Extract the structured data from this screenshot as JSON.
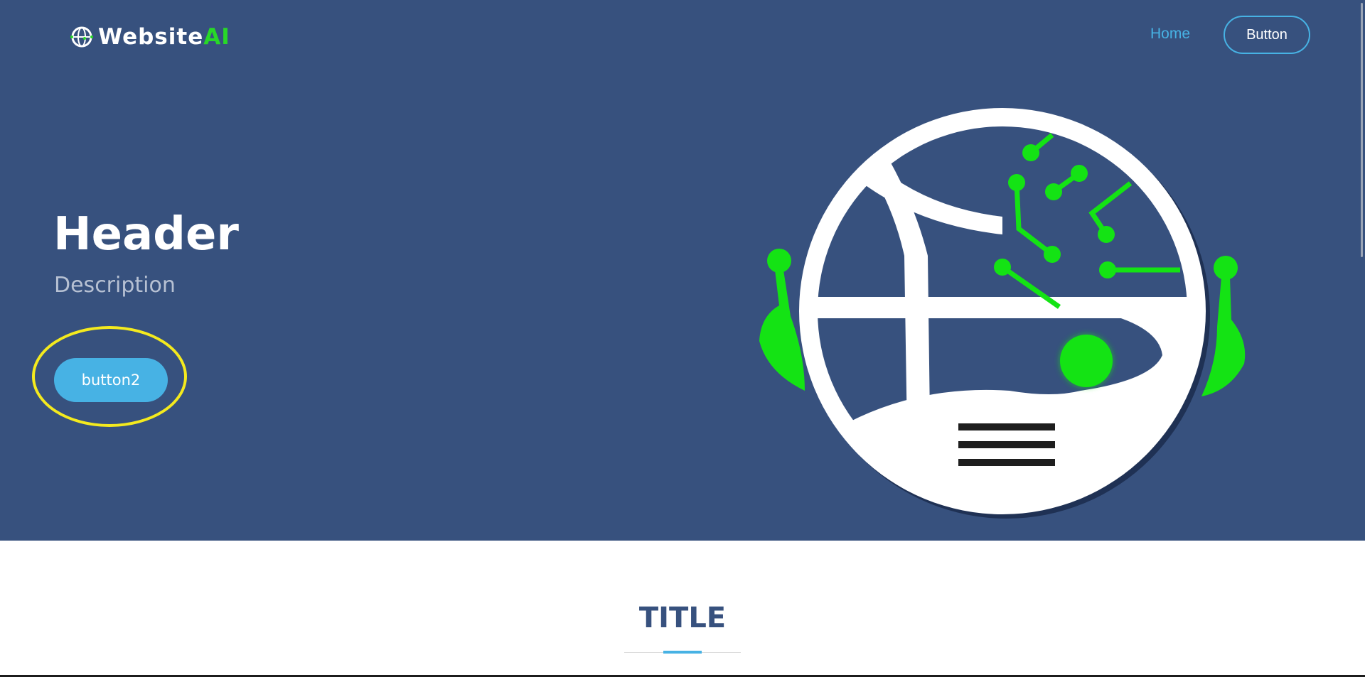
{
  "navbar": {
    "logo_text": "Website",
    "logo_accent": "AI",
    "home_label": "Home",
    "button_label": "Button"
  },
  "hero": {
    "title": "Header",
    "description": "Description",
    "cta_label": "button2",
    "illustration_icon": "globe-robot-icon"
  },
  "section": {
    "title": "TITLE"
  },
  "colors": {
    "hero_background": "#37517e",
    "accent_blue": "#47b2e4",
    "accent_green": "#28d828",
    "highlight_yellow": "#f4ea1e"
  }
}
